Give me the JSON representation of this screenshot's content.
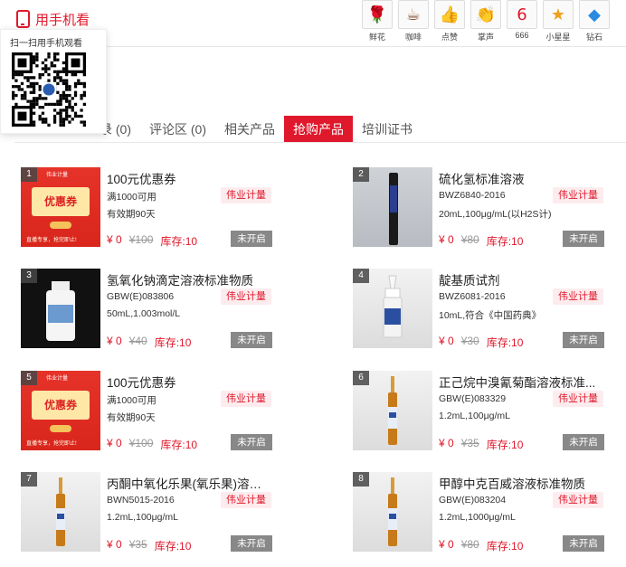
{
  "header": {
    "mobile_label": "用手机看",
    "qr_title": "扫一扫用手机观看",
    "gifts": [
      {
        "label": "鲜花",
        "icon": "rose-icon",
        "glyph": "🌹"
      },
      {
        "label": "咖啡",
        "icon": "coffee-icon",
        "glyph": "☕"
      },
      {
        "label": "点赞",
        "icon": "thumbs-up-icon",
        "glyph": "👍"
      },
      {
        "label": "掌声",
        "icon": "clap-icon",
        "glyph": "👏"
      },
      {
        "label": "666",
        "icon": "666-icon",
        "glyph": "6"
      },
      {
        "label": "小星星",
        "icon": "star-icon",
        "glyph": "★"
      },
      {
        "label": "钻石",
        "icon": "diamond-icon",
        "glyph": "◆"
      }
    ]
  },
  "tabs": [
    {
      "label": "录 (0)"
    },
    {
      "label": "评论区 (0)"
    },
    {
      "label": "相关产品"
    },
    {
      "label": "抢购产品",
      "active": true
    },
    {
      "label": "培训证书"
    }
  ],
  "products": [
    {
      "rank": "1",
      "name": "100元优惠券",
      "code": "满1000可用",
      "spec": "有效期90天",
      "brand": "伟业计量",
      "price": "¥ 0",
      "old_price": "¥100",
      "stock": "库存:10",
      "button": "未开启",
      "art": "coupon"
    },
    {
      "rank": "2",
      "name": "硫化氢标准溶液",
      "code": "BWZ6840-2016",
      "spec": "20mL,100μg/mL(以H2S计)",
      "brand": "伟业计量",
      "price": "¥ 0",
      "old_price": "¥80",
      "stock": "库存:10",
      "button": "未开启",
      "art": "vial-dark"
    },
    {
      "rank": "3",
      "name": "氢氧化钠滴定溶液标准物质",
      "code": "GBW(E)083806",
      "spec": "50mL,1.003mol/L",
      "brand": "伟业计量",
      "price": "¥ 0",
      "old_price": "¥40",
      "stock": "库存:10",
      "button": "未开启",
      "art": "bottle-dark"
    },
    {
      "rank": "4",
      "name": "靛基质试剂",
      "code": "BWZ6081-2016",
      "spec": "10mL,符合《中国药典》",
      "brand": "伟业计量",
      "price": "¥ 0",
      "old_price": "¥30",
      "stock": "库存:10",
      "button": "未开启",
      "art": "dropper"
    },
    {
      "rank": "5",
      "name": "100元优惠券",
      "code": "满1000可用",
      "spec": "有效期90天",
      "brand": "伟业计量",
      "price": "¥ 0",
      "old_price": "¥100",
      "stock": "库存:10",
      "button": "未开启",
      "art": "coupon"
    },
    {
      "rank": "6",
      "name": "正己烷中溴氰菊酯溶液标准...",
      "code": "GBW(E)083329",
      "spec": "1.2mL,100μg/mL",
      "brand": "伟业计量",
      "price": "¥ 0",
      "old_price": "¥35",
      "stock": "库存:10",
      "button": "未开启",
      "art": "ampoule"
    },
    {
      "rank": "7",
      "name": "丙酮中氧化乐果(氧乐果)溶液...",
      "code": "BWN5015-2016",
      "spec": "1.2mL,100μg/mL",
      "brand": "伟业计量",
      "price": "¥ 0",
      "old_price": "¥35",
      "stock": "库存:10",
      "button": "未开启",
      "art": "ampoule"
    },
    {
      "rank": "8",
      "name": "甲醇中克百威溶液标准物质",
      "code": "GBW(E)083204",
      "spec": "1.2mL,1000μg/mL",
      "brand": "伟业计量",
      "price": "¥ 0",
      "old_price": "¥80",
      "stock": "库存:10",
      "button": "未开启",
      "art": "ampoule"
    }
  ],
  "coupon_art": {
    "header": "伟业计量",
    "ticket": "优惠券",
    "footer": "直播专享，抢完即止!"
  },
  "colors": {
    "accent": "#e0182b",
    "button_disabled": "#888888"
  }
}
